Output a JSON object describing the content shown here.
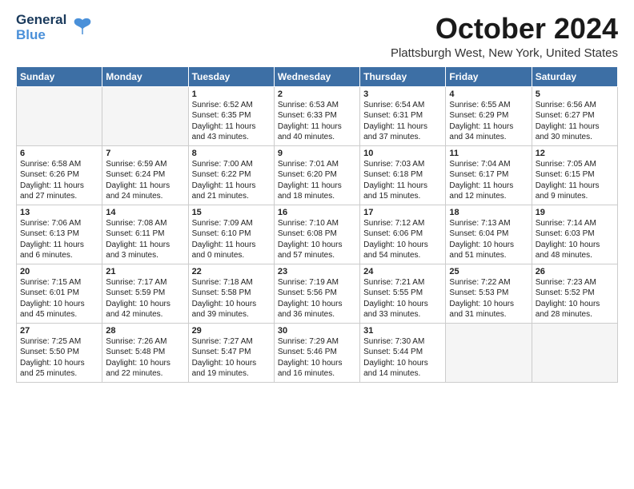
{
  "header": {
    "logo_general": "General",
    "logo_blue": "Blue",
    "month_title": "October 2024",
    "location": "Plattsburgh West, New York, United States"
  },
  "weekdays": [
    "Sunday",
    "Monday",
    "Tuesday",
    "Wednesday",
    "Thursday",
    "Friday",
    "Saturday"
  ],
  "weeks": [
    [
      {
        "num": "",
        "info": ""
      },
      {
        "num": "",
        "info": ""
      },
      {
        "num": "1",
        "info": "Sunrise: 6:52 AM\nSunset: 6:35 PM\nDaylight: 11 hours and 43 minutes."
      },
      {
        "num": "2",
        "info": "Sunrise: 6:53 AM\nSunset: 6:33 PM\nDaylight: 11 hours and 40 minutes."
      },
      {
        "num": "3",
        "info": "Sunrise: 6:54 AM\nSunset: 6:31 PM\nDaylight: 11 hours and 37 minutes."
      },
      {
        "num": "4",
        "info": "Sunrise: 6:55 AM\nSunset: 6:29 PM\nDaylight: 11 hours and 34 minutes."
      },
      {
        "num": "5",
        "info": "Sunrise: 6:56 AM\nSunset: 6:27 PM\nDaylight: 11 hours and 30 minutes."
      }
    ],
    [
      {
        "num": "6",
        "info": "Sunrise: 6:58 AM\nSunset: 6:26 PM\nDaylight: 11 hours and 27 minutes."
      },
      {
        "num": "7",
        "info": "Sunrise: 6:59 AM\nSunset: 6:24 PM\nDaylight: 11 hours and 24 minutes."
      },
      {
        "num": "8",
        "info": "Sunrise: 7:00 AM\nSunset: 6:22 PM\nDaylight: 11 hours and 21 minutes."
      },
      {
        "num": "9",
        "info": "Sunrise: 7:01 AM\nSunset: 6:20 PM\nDaylight: 11 hours and 18 minutes."
      },
      {
        "num": "10",
        "info": "Sunrise: 7:03 AM\nSunset: 6:18 PM\nDaylight: 11 hours and 15 minutes."
      },
      {
        "num": "11",
        "info": "Sunrise: 7:04 AM\nSunset: 6:17 PM\nDaylight: 11 hours and 12 minutes."
      },
      {
        "num": "12",
        "info": "Sunrise: 7:05 AM\nSunset: 6:15 PM\nDaylight: 11 hours and 9 minutes."
      }
    ],
    [
      {
        "num": "13",
        "info": "Sunrise: 7:06 AM\nSunset: 6:13 PM\nDaylight: 11 hours and 6 minutes."
      },
      {
        "num": "14",
        "info": "Sunrise: 7:08 AM\nSunset: 6:11 PM\nDaylight: 11 hours and 3 minutes."
      },
      {
        "num": "15",
        "info": "Sunrise: 7:09 AM\nSunset: 6:10 PM\nDaylight: 11 hours and 0 minutes."
      },
      {
        "num": "16",
        "info": "Sunrise: 7:10 AM\nSunset: 6:08 PM\nDaylight: 10 hours and 57 minutes."
      },
      {
        "num": "17",
        "info": "Sunrise: 7:12 AM\nSunset: 6:06 PM\nDaylight: 10 hours and 54 minutes."
      },
      {
        "num": "18",
        "info": "Sunrise: 7:13 AM\nSunset: 6:04 PM\nDaylight: 10 hours and 51 minutes."
      },
      {
        "num": "19",
        "info": "Sunrise: 7:14 AM\nSunset: 6:03 PM\nDaylight: 10 hours and 48 minutes."
      }
    ],
    [
      {
        "num": "20",
        "info": "Sunrise: 7:15 AM\nSunset: 6:01 PM\nDaylight: 10 hours and 45 minutes."
      },
      {
        "num": "21",
        "info": "Sunrise: 7:17 AM\nSunset: 5:59 PM\nDaylight: 10 hours and 42 minutes."
      },
      {
        "num": "22",
        "info": "Sunrise: 7:18 AM\nSunset: 5:58 PM\nDaylight: 10 hours and 39 minutes."
      },
      {
        "num": "23",
        "info": "Sunrise: 7:19 AM\nSunset: 5:56 PM\nDaylight: 10 hours and 36 minutes."
      },
      {
        "num": "24",
        "info": "Sunrise: 7:21 AM\nSunset: 5:55 PM\nDaylight: 10 hours and 33 minutes."
      },
      {
        "num": "25",
        "info": "Sunrise: 7:22 AM\nSunset: 5:53 PM\nDaylight: 10 hours and 31 minutes."
      },
      {
        "num": "26",
        "info": "Sunrise: 7:23 AM\nSunset: 5:52 PM\nDaylight: 10 hours and 28 minutes."
      }
    ],
    [
      {
        "num": "27",
        "info": "Sunrise: 7:25 AM\nSunset: 5:50 PM\nDaylight: 10 hours and 25 minutes."
      },
      {
        "num": "28",
        "info": "Sunrise: 7:26 AM\nSunset: 5:48 PM\nDaylight: 10 hours and 22 minutes."
      },
      {
        "num": "29",
        "info": "Sunrise: 7:27 AM\nSunset: 5:47 PM\nDaylight: 10 hours and 19 minutes."
      },
      {
        "num": "30",
        "info": "Sunrise: 7:29 AM\nSunset: 5:46 PM\nDaylight: 10 hours and 16 minutes."
      },
      {
        "num": "31",
        "info": "Sunrise: 7:30 AM\nSunset: 5:44 PM\nDaylight: 10 hours and 14 minutes."
      },
      {
        "num": "",
        "info": ""
      },
      {
        "num": "",
        "info": ""
      }
    ]
  ]
}
